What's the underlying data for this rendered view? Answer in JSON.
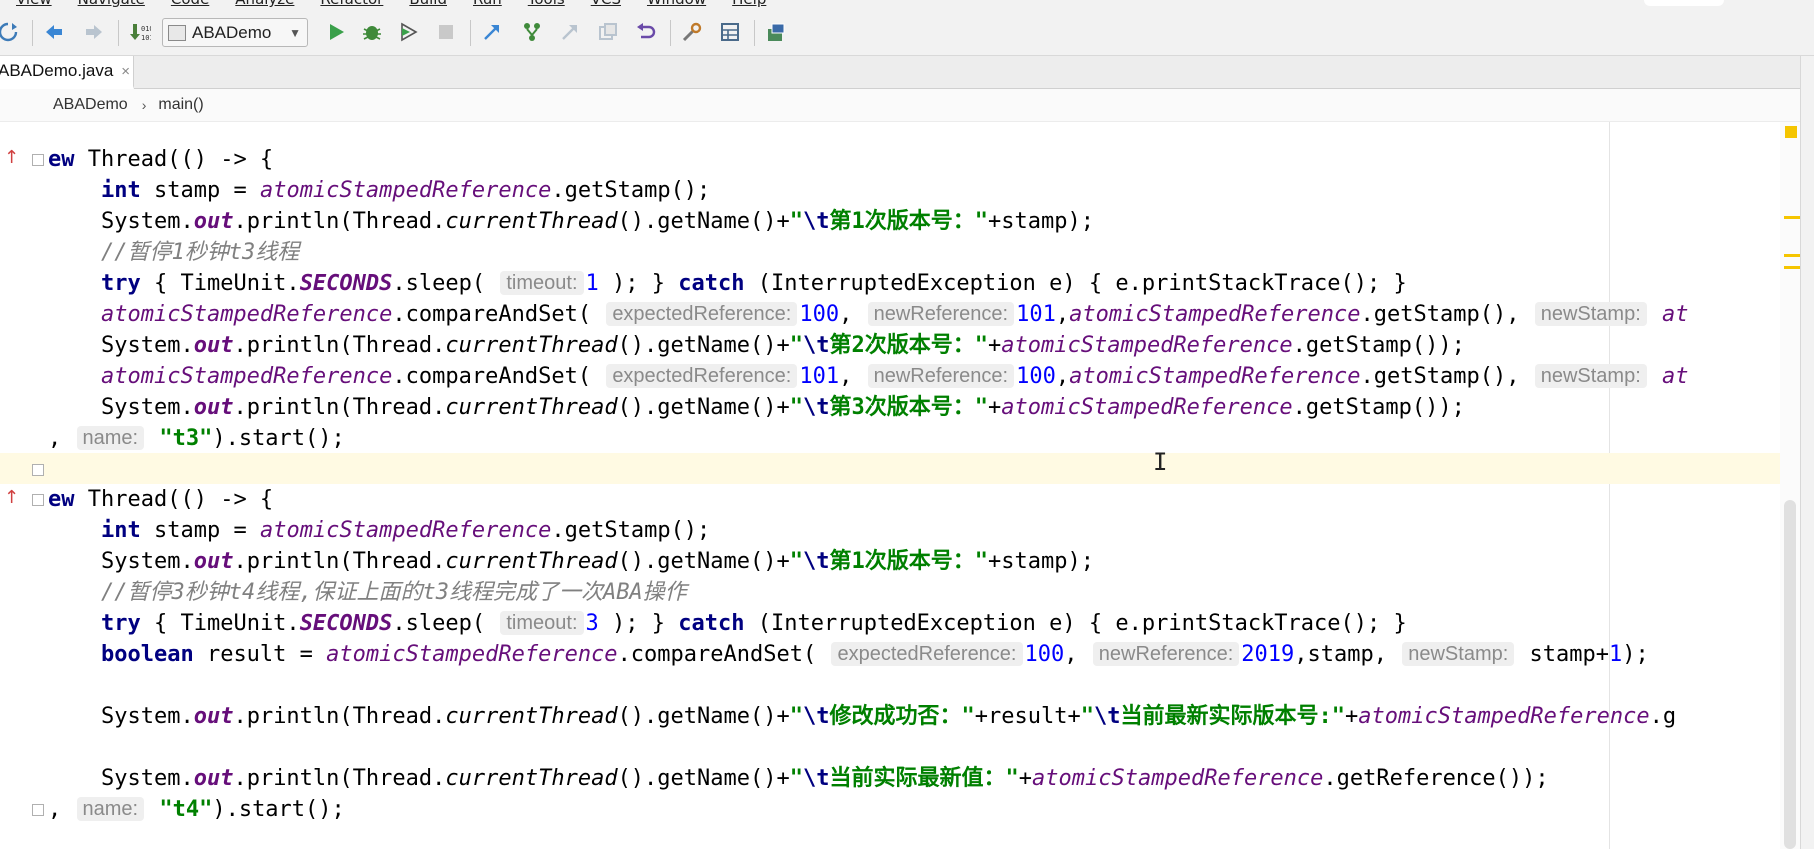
{
  "menu": {
    "items": [
      "View",
      "Navigate",
      "Code",
      "Analyze",
      "Refactor",
      "Build",
      "Run",
      "Tools",
      "VCS",
      "Window",
      "Help"
    ]
  },
  "toolbar": {
    "run_config_label": "ABADemo",
    "icons": [
      "sync-icon",
      "back-icon",
      "forward-icon",
      "build-icon",
      "run-icon",
      "debug-icon",
      "coverage-icon",
      "stop-icon",
      "vcs-update-icon",
      "vcs-commit-icon",
      "history-icon",
      "revert-icon",
      "settings-icon",
      "project-structure-icon",
      "database-icon"
    ]
  },
  "tabs": [
    {
      "label": "ABADemo.java",
      "close": "×"
    }
  ],
  "breadcrumb": {
    "class_name": "ABADemo",
    "separator": "›",
    "method_name": "main()"
  },
  "code": {
    "l01": {
      "a": "ew",
      "b": " Thread(() -> {"
    },
    "l02": {
      "a": "    ",
      "kw": "int",
      "b": " stamp = ",
      "f": "atomicStampedReference",
      "c": ".getStamp();"
    },
    "l03": {
      "a": "    System.",
      "out": "out",
      "b": ".println(Thread.",
      "ct": "currentThread",
      "c": "().getName()+",
      "q1": "\"",
      "esc": "\\t",
      "s": "第1次版本号：",
      "q2": "\"",
      "d": "+stamp);"
    },
    "l04": {
      "cmt": "    //暂停1秒钟t3线程"
    },
    "l05": {
      "a": "    ",
      "try": "try",
      "b": " { TimeUnit.",
      "sec": "SECONDS",
      "c": ".sleep( ",
      "hint": "timeout:",
      "num": "1",
      "d": " ); } ",
      "catch": "catch",
      "e": " (InterruptedException e) { e.printStackTrace(); }"
    },
    "l06": {
      "a": "    ",
      "f1": "atomicStampedReference",
      "b": ".compareAndSet( ",
      "h1": "expectedReference:",
      "n1": "100",
      "c": ", ",
      "h2": "newReference:",
      "n2": "101",
      "d": ",",
      "f2": "atomicStampedReference",
      "e": ".getStamp(), ",
      "h3": "newStamp:",
      "f3": " at"
    },
    "l07": {
      "a": "    System.",
      "out": "out",
      "b": ".println(Thread.",
      "ct": "currentThread",
      "c": "().getName()+",
      "q1": "\"",
      "esc": "\\t",
      "s": "第2次版本号：",
      "q2": "\"",
      "d": "+",
      "f": "atomicStampedReference",
      "e": ".getStamp());"
    },
    "l08": {
      "a": "    ",
      "f1": "atomicStampedReference",
      "b": ".compareAndSet( ",
      "h1": "expectedReference:",
      "n1": "101",
      "c": ", ",
      "h2": "newReference:",
      "n2": "100",
      "d": ",",
      "f2": "atomicStampedReference",
      "e": ".getStamp(), ",
      "h3": "newStamp:",
      "f3": " at"
    },
    "l09": {
      "a": "    System.",
      "out": "out",
      "b": ".println(Thread.",
      "ct": "currentThread",
      "c": "().getName()+",
      "q1": "\"",
      "esc": "\\t",
      "s": "第3次版本号：",
      "q2": "\"",
      "d": "+",
      "f": "atomicStampedReference",
      "e": ".getStamp());"
    },
    "l10": {
      "a": ", ",
      "hint": "name:",
      "b": " ",
      "s": "\"t3\"",
      "c": ").start();"
    },
    "l12": {
      "a": "ew",
      "b": " Thread(() -> {"
    },
    "l13": {
      "a": "    ",
      "kw": "int",
      "b": " stamp = ",
      "f": "atomicStampedReference",
      "c": ".getStamp();"
    },
    "l14": {
      "a": "    System.",
      "out": "out",
      "b": ".println(Thread.",
      "ct": "currentThread",
      "c": "().getName()+",
      "q1": "\"",
      "esc": "\\t",
      "s": "第1次版本号：",
      "q2": "\"",
      "d": "+stamp);"
    },
    "l15": {
      "cmt": "    //暂停3秒钟t4线程,保证上面的t3线程完成了一次ABA操作"
    },
    "l16": {
      "a": "    ",
      "try": "try",
      "b": " { TimeUnit.",
      "sec": "SECONDS",
      "c": ".sleep( ",
      "hint": "timeout:",
      "num": "3",
      "d": " ); } ",
      "catch": "catch",
      "e": " (InterruptedException e) { e.printStackTrace(); }"
    },
    "l17": {
      "a": "    ",
      "kw": "boolean",
      "b": " result = ",
      "f": "atomicStampedReference",
      "c": ".compareAndSet( ",
      "h1": "expectedReference:",
      "n1": "100",
      "d": ", ",
      "h2": "newReference:",
      "n2": "2019",
      "e": ",stamp, ",
      "h3": "newStamp:",
      "g": " stamp+",
      "n3": "1",
      "h": ");"
    },
    "l19": {
      "a": "    System.",
      "out": "out",
      "b": ".println(Thread.",
      "ct": "currentThread",
      "c": "().getName()+",
      "q1": "\"",
      "esc": "\\t",
      "s": "修改成功否：",
      "q2": "\"",
      "d": "+result+",
      "q3": "\"",
      "esc2": "\\t",
      "s2": "当前最新实际版本号:",
      "q4": "\"",
      "e": "+",
      "f": "atomicStampedReference",
      "g": ".g"
    },
    "l21": {
      "a": "    System.",
      "out": "out",
      "b": ".println(Thread.",
      "ct": "currentThread",
      "c": "().getName()+",
      "q1": "\"",
      "esc": "\\t",
      "s": "当前实际最新值：",
      "q2": "\"",
      "d": "+",
      "f": "atomicStampedReference",
      "e": ".getReference());"
    },
    "l22": {
      "a": ", ",
      "hint": "name:",
      "b": " ",
      "s": "\"t4\"",
      "c": ").start();"
    }
  }
}
